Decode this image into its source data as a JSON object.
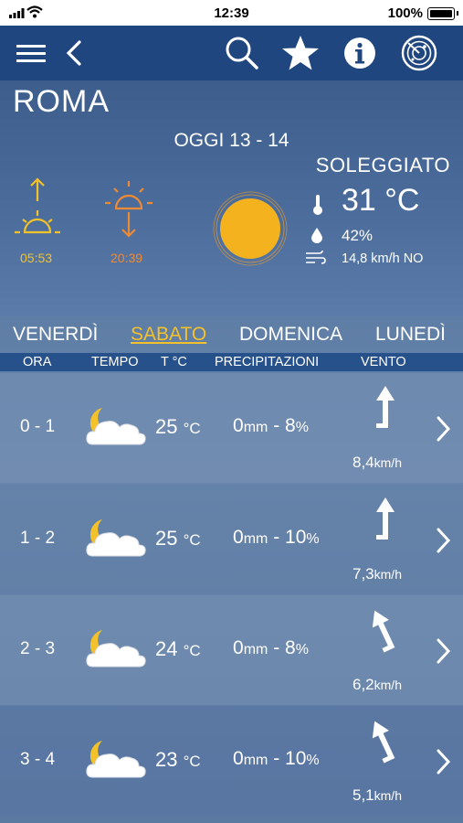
{
  "status": {
    "time": "12:39",
    "battery": "100%"
  },
  "toolbar": {
    "menu": "menu-icon",
    "back": "back-icon",
    "search": "search-icon",
    "favorite": "star-icon",
    "info": "info-icon",
    "radar": "radar-icon"
  },
  "hero": {
    "city": "ROMA",
    "today": "OGGI 13 - 14",
    "condition": "SOLEGGIATO",
    "sunrise": "05:53",
    "sunset": "20:39",
    "temperature": "31 °C",
    "humidity": "42%",
    "wind": "14,8 km/h NO"
  },
  "days": [
    "VENERDÌ",
    "SABATO",
    "DOMENICA",
    "LUNEDÌ"
  ],
  "active_day": "SABATO",
  "columns": {
    "hour": "ORA",
    "weather": "TEMPO",
    "temp": "T °C",
    "precip": "PRECIPITAZIONI",
    "wind": "VENTO"
  },
  "rows": [
    {
      "hour": "0 - 1",
      "temp": "25",
      "temp_unit": "°C",
      "mm": "0",
      "mm_unit": "mm",
      "sep": "-",
      "pct": "8",
      "pct_unit": "%",
      "wind": "8,4",
      "wind_unit": "km/h"
    },
    {
      "hour": "1 - 2",
      "temp": "25",
      "temp_unit": "°C",
      "mm": "0",
      "mm_unit": "mm",
      "sep": "-",
      "pct": "10",
      "pct_unit": "%",
      "wind": "7,3",
      "wind_unit": "km/h"
    },
    {
      "hour": "2 - 3",
      "temp": "24",
      "temp_unit": "°C",
      "mm": "0",
      "mm_unit": "mm",
      "sep": "-",
      "pct": "8",
      "pct_unit": "%",
      "wind": "6,2",
      "wind_unit": "km/h"
    },
    {
      "hour": "3 - 4",
      "temp": "23",
      "temp_unit": "°C",
      "mm": "0",
      "mm_unit": "mm",
      "sep": "-",
      "pct": "10",
      "pct_unit": "%",
      "wind": "5,1",
      "wind_unit": "km/h"
    }
  ],
  "colors": {
    "toolbar": "#1f467f",
    "accent": "#f3c12a",
    "sunset": "#ec8a35"
  }
}
